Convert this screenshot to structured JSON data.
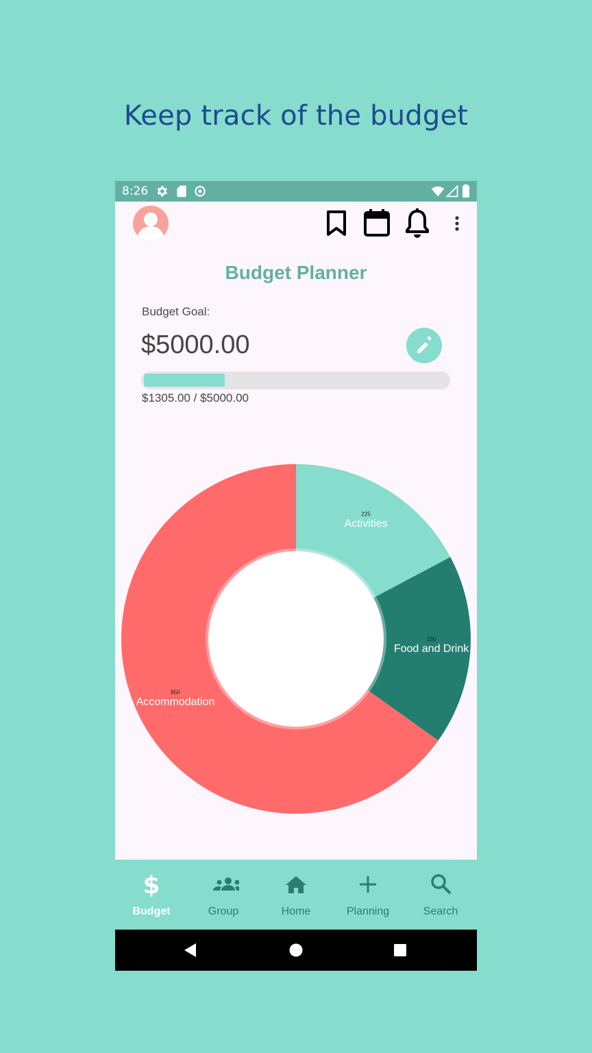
{
  "caption": "Keep track of the budget",
  "status_bar": {
    "time": "8:26"
  },
  "app": {
    "title": "Budget Planner",
    "budget_goal_label": "Budget Goal:",
    "budget_goal_value": "$5000.00",
    "progress_text": "$1305.00 / $5000.00",
    "progress_fraction": 0.261,
    "colors": {
      "accent": "#86dccd",
      "title": "#63b0a3",
      "avatar": "#f8a39a"
    }
  },
  "toolbar_icons": [
    "bookmark-icon",
    "calendar-icon",
    "bell-icon",
    "more-vert-icon"
  ],
  "chart_data": {
    "type": "pie",
    "donut": true,
    "slices": [
      {
        "label": "Activities",
        "value": 225,
        "color": "#86dccd"
      },
      {
        "label": "Food and Drink",
        "value": 230,
        "color": "#237e70"
      },
      {
        "label": "Accommodation",
        "value": 850,
        "color": "#ff6b6b"
      }
    ]
  },
  "bottom_nav": {
    "items": [
      {
        "label": "Budget",
        "icon": "dollar-icon",
        "active": true
      },
      {
        "label": "Group",
        "icon": "group-icon",
        "active": false
      },
      {
        "label": "Home",
        "icon": "home-icon",
        "active": false
      },
      {
        "label": "Planning",
        "icon": "plus-icon",
        "active": false
      },
      {
        "label": "Search",
        "icon": "search-icon",
        "active": false
      }
    ]
  }
}
